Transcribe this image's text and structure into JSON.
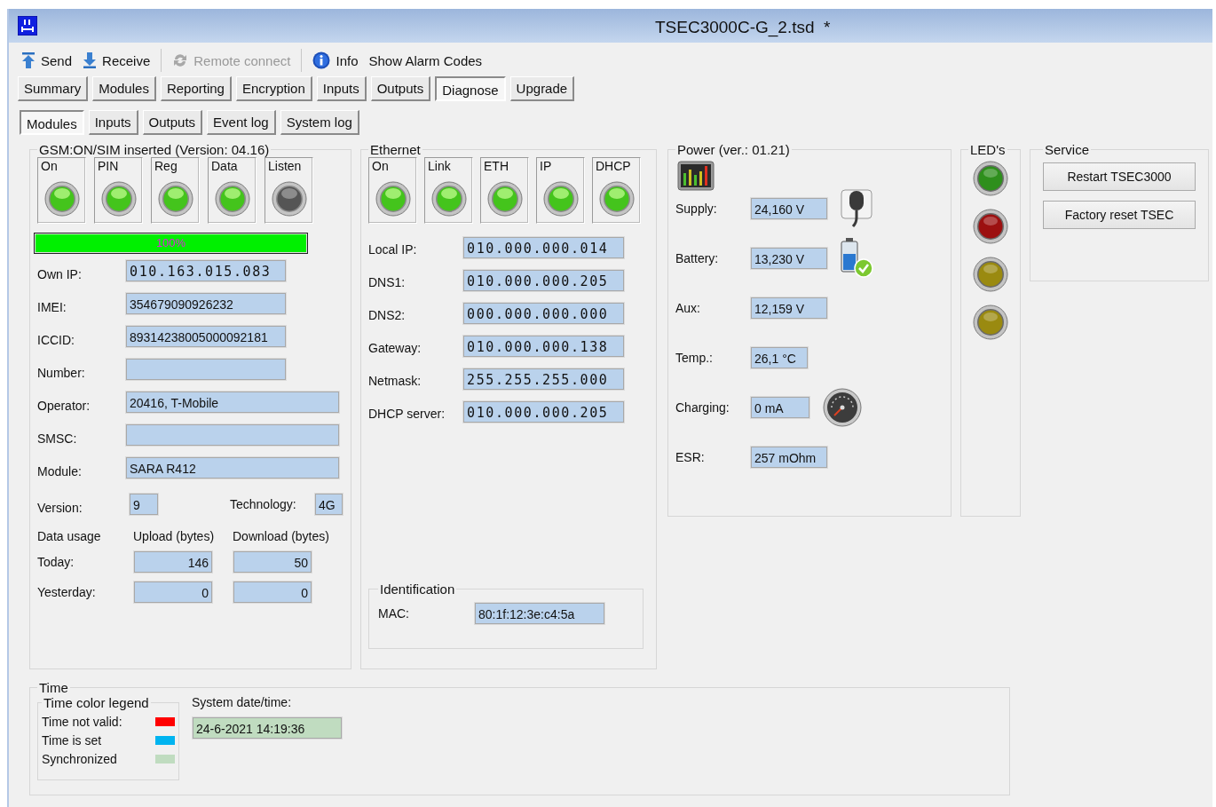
{
  "window": {
    "title": "TSEC3000C-G_2.tsd  *"
  },
  "toolbar": [
    {
      "label": "Send",
      "disabled": false
    },
    {
      "label": "Receive",
      "disabled": false
    },
    {
      "label": "Remote connect",
      "disabled": true
    },
    {
      "label": "Info",
      "disabled": false
    },
    {
      "label": "Show Alarm Codes",
      "disabled": false
    }
  ],
  "tabs": [
    {
      "label": "Summary",
      "selected": false
    },
    {
      "label": "Modules",
      "selected": false
    },
    {
      "label": "Reporting",
      "selected": false
    },
    {
      "label": "Encryption",
      "selected": false
    },
    {
      "label": "Inputs",
      "selected": false
    },
    {
      "label": "Outputs",
      "selected": false
    },
    {
      "label": "Diagnose",
      "selected": true
    },
    {
      "label": "Upgrade",
      "selected": false
    }
  ],
  "subtabs": [
    {
      "label": "Modules",
      "selected": true
    },
    {
      "label": "Inputs",
      "selected": false
    },
    {
      "label": "Outputs",
      "selected": false
    },
    {
      "label": "Event log",
      "selected": false
    },
    {
      "label": "System log",
      "selected": false
    }
  ],
  "gsm": {
    "legend": "GSM:ON/SIM inserted (Version: 04.16)",
    "indicators": [
      {
        "label": "On",
        "on": true
      },
      {
        "label": "PIN",
        "on": true
      },
      {
        "label": "Reg",
        "on": true
      },
      {
        "label": "Data",
        "on": true
      },
      {
        "label": "Listen",
        "on": false
      }
    ],
    "signal": {
      "label": "100%",
      "level": 1.0
    },
    "fields": [
      {
        "label": "Own IP:",
        "value": "010.163.015.083",
        "kind": "ip"
      },
      {
        "label": "IMEI:",
        "value": "354679090926232",
        "kind": "text"
      },
      {
        "label": "ICCID:",
        "value": "89314238005000092181",
        "kind": "text"
      },
      {
        "label": "Number:",
        "kind": "text"
      },
      {
        "label": "Operator:",
        "value": "20416, T-Mobile",
        "kind": "text"
      },
      {
        "label": "SMSC:",
        "kind": "text"
      },
      {
        "label": "Module:",
        "value": "SARA R412",
        "kind": "text"
      }
    ],
    "version": {
      "label": "Version:",
      "value": "9"
    },
    "technology": {
      "label": "Technology:",
      "value": "4G"
    },
    "data_usage": {
      "title": "Data usage",
      "columns": [
        "Upload (bytes)",
        "Download (bytes)"
      ],
      "rows": [
        {
          "label": "Today:",
          "upload": "146",
          "download": "50"
        },
        {
          "label": "Yesterday:",
          "upload": "0",
          "download": "0"
        }
      ]
    }
  },
  "ethernet": {
    "legend": "Ethernet",
    "indicators": [
      {
        "label": "On",
        "on": true
      },
      {
        "label": "Link",
        "on": true
      },
      {
        "label": "ETH",
        "on": true
      },
      {
        "label": "IP",
        "on": true
      },
      {
        "label": "DHCP",
        "on": true
      }
    ],
    "fields": [
      {
        "label": "Local IP:",
        "value": "010.000.000.014"
      },
      {
        "label": "DNS1:",
        "value": "010.000.000.205"
      },
      {
        "label": "DNS2:",
        "value": "000.000.000.000"
      },
      {
        "label": "Gateway:",
        "value": "010.000.000.138"
      },
      {
        "label": "Netmask:",
        "value": "255.255.255.000"
      },
      {
        "label": "DHCP server:",
        "value": "010.000.000.205"
      }
    ],
    "identification": {
      "legend": "Identification",
      "fields": [
        {
          "label": "MAC:",
          "value": "80:1f:12:3e:c4:5a"
        }
      ]
    }
  },
  "power": {
    "legend": "Power (ver.: 01.21)",
    "rows": [
      {
        "label": "Supply:",
        "value": "24,160 V"
      },
      {
        "label": "Battery:",
        "value": "13,230 V"
      },
      {
        "label": "Aux:",
        "value": "12,159 V"
      },
      {
        "label": "Temp.:",
        "value": "26,1 °C"
      },
      {
        "label": "Charging:",
        "value": "0 mA"
      },
      {
        "label": "ESR:",
        "value": "257 mOhm"
      }
    ]
  },
  "leds": {
    "legend": "LED's",
    "items": [
      {
        "color": "#2e8f1c"
      },
      {
        "color": "#9c1010"
      },
      {
        "color": "#9a8a10"
      },
      {
        "color": "#9a8a10"
      }
    ]
  },
  "service": {
    "legend": "Service",
    "buttons": [
      "Restart TSEC3000",
      "Factory reset TSEC"
    ]
  },
  "time": {
    "legend": "Time",
    "color_legend": {
      "title": "Time color legend",
      "items": [
        {
          "label": "Time not valid:",
          "color": "#ff0000"
        },
        {
          "label": "Time is set",
          "color": "#00b4f0"
        },
        {
          "label": "Synchronized",
          "color": "#c0dcc0"
        }
      ]
    },
    "system": {
      "label": "System date/time:",
      "value": "24-6-2021 14:19:36"
    }
  }
}
